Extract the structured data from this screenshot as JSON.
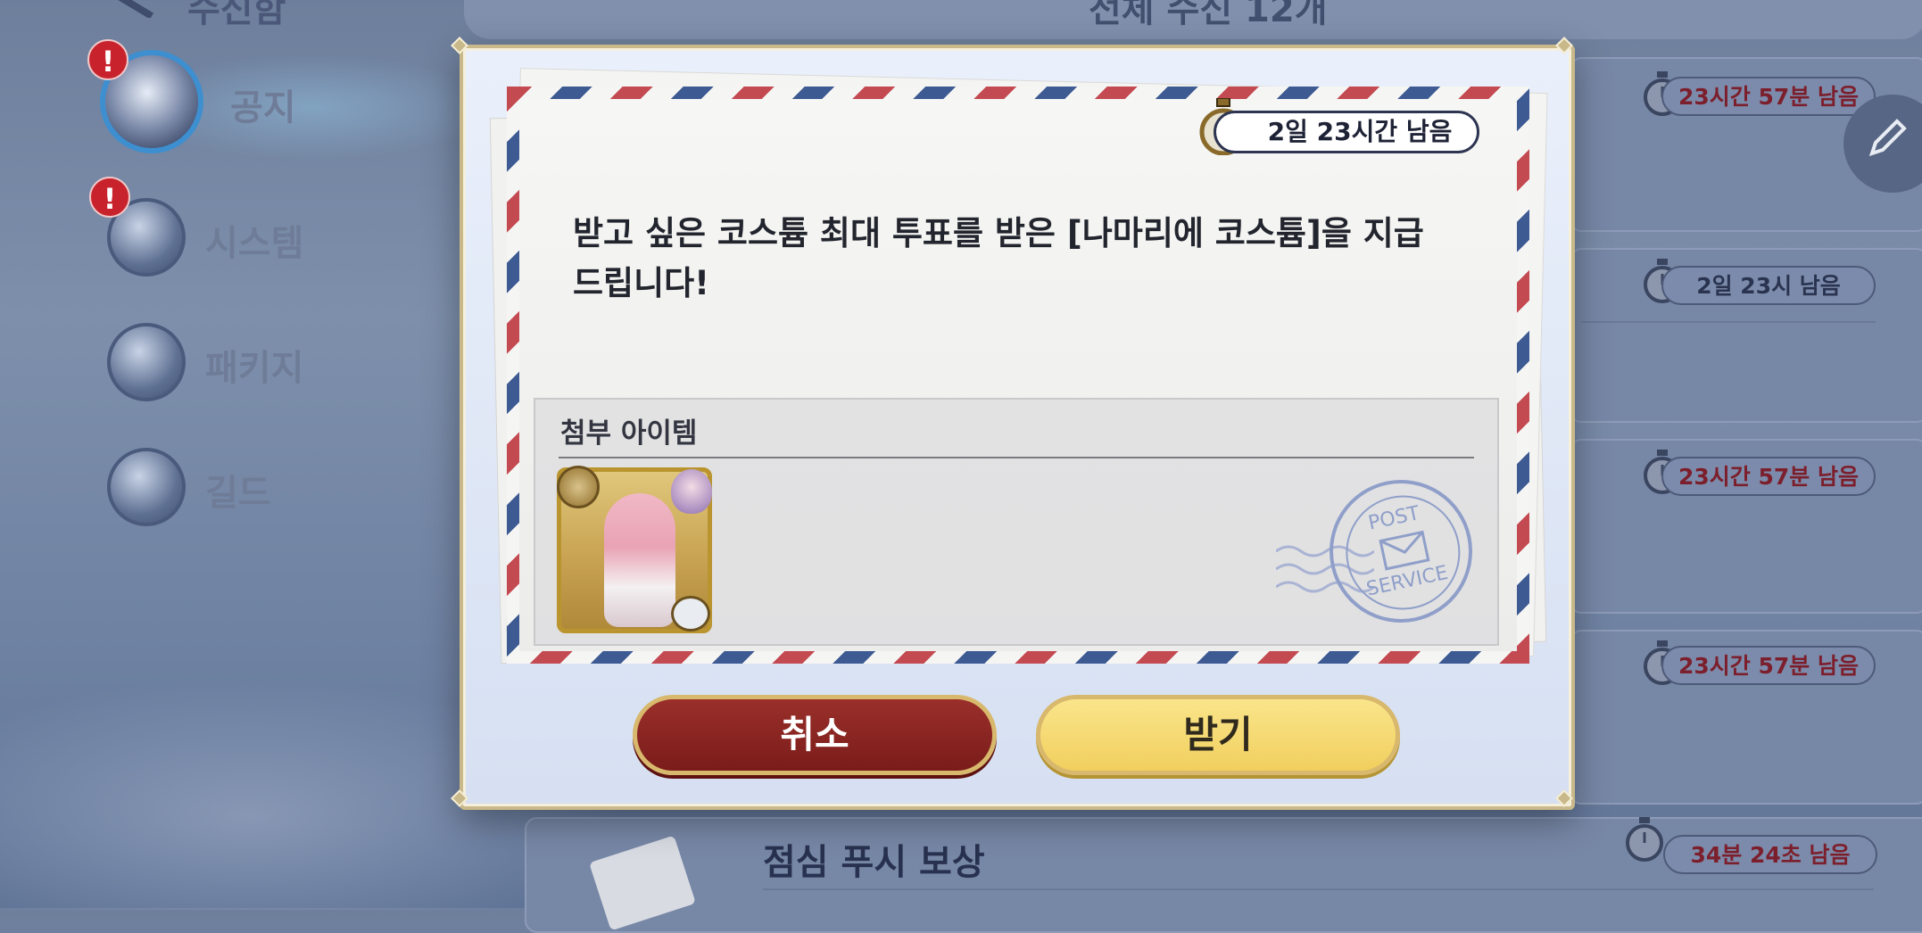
{
  "header": {
    "left_title": "수신함",
    "count_text": "전체 수신 12개"
  },
  "categories": [
    {
      "label": "공지",
      "alert": "!"
    },
    {
      "label": "시스템",
      "alert": "!"
    },
    {
      "label": "패키지"
    },
    {
      "label": "길드"
    }
  ],
  "mail_list": [
    {
      "timer": "23시간 57분 남음"
    },
    {
      "timer": "2일 23시 남음"
    },
    {
      "timer": "23시간 57분 남음"
    },
    {
      "timer": "23시간 57분 남음"
    },
    {
      "title": "점심 푸시 보상",
      "timer": "34분 24초 남음"
    }
  ],
  "modal": {
    "timer": "2일 23시간 남음",
    "message": "받고 싶은 코스튬 최대 투표를 받은 [나마리에 코스튬]을 지급 드립니다!",
    "attachments_title": "첨부 아이템",
    "stamp_top": "POST",
    "stamp_bottom": "SERVICE",
    "cancel_label": "취소",
    "receive_label": "받기"
  },
  "colors": {
    "cancel_button": "#7a1c1a",
    "receive_button": "#f1cf5e",
    "timer_red_text": "#7c1f2c",
    "airmail_red": "#c44a52",
    "airmail_blue": "#3d5a93"
  },
  "icons": [
    "back-arrow-icon",
    "notice-icon",
    "system-icon",
    "package-icon",
    "guild-icon",
    "stopwatch-icon",
    "edit-pencil-icon",
    "post-stamp-icon"
  ]
}
